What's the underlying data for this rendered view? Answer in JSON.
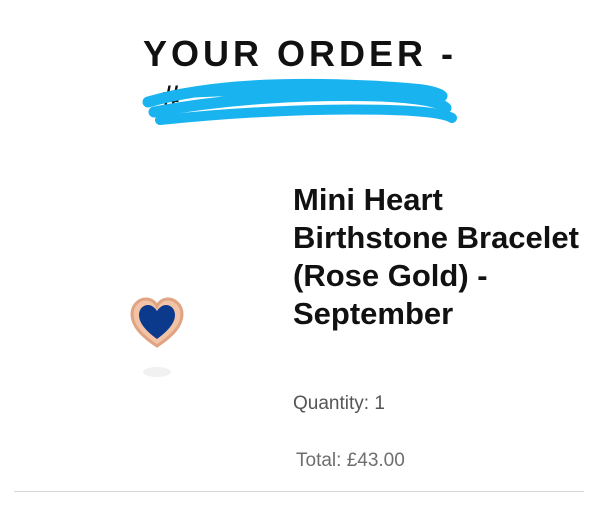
{
  "order": {
    "title": "YOUR ORDER -",
    "number_label": "#"
  },
  "product": {
    "name": "Mini Heart Birthstone Bracelet (Rose Gold) - September",
    "image_icon": "heart-birthstone-icon",
    "quantity_label": "Quantity:",
    "quantity_value": "1",
    "total_label": "Total:",
    "total_value": "£43.00"
  },
  "colors": {
    "redaction": "#19b4f0",
    "gem": "#0b3a8c",
    "rose_gold": "#e7b08f"
  }
}
